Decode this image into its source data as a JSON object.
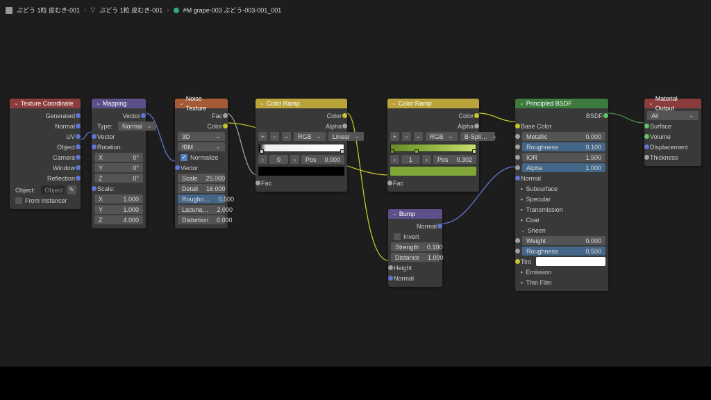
{
  "breadcrumb": {
    "a": "ぶどう 1粒 皮むき-001",
    "b": "ぶどう 1粒 皮むき-001",
    "c": "#M grape-003 ぶどう-003-001_001"
  },
  "texcoord": {
    "title": "Texture Coordinate",
    "outputs": [
      "Generated",
      "Normal",
      "UV",
      "Object",
      "Camera",
      "Window",
      "Reflection"
    ],
    "object_label": "Object:",
    "object_value": "Object",
    "from_instancer": "From Instancer"
  },
  "mapping": {
    "title": "Mapping",
    "out_vector": "Vector",
    "type_label": "Type:",
    "type_value": "Normal",
    "in_vector": "Vector",
    "rotation_label": "Rotation:",
    "rot": [
      [
        "X",
        "0°"
      ],
      [
        "Y",
        "0°"
      ],
      [
        "Z",
        "0°"
      ]
    ],
    "scale_label": "Scale:",
    "scale": [
      [
        "X",
        "1.000"
      ],
      [
        "Y",
        "1.000"
      ],
      [
        "Z",
        "4.000"
      ]
    ]
  },
  "noise": {
    "title": "Noise Texture",
    "out_fac": "Fac",
    "out_color": "Color",
    "dim": "3D",
    "mode": "fBM",
    "normalize": "Normalize",
    "in_vector": "Vector",
    "params": [
      [
        "Scale",
        "25.000"
      ],
      [
        "Detail",
        "16.000"
      ],
      [
        "Roughn…",
        "0.500"
      ],
      [
        "Lacuna…",
        "2.000"
      ],
      [
        "Distortion",
        "0.000"
      ]
    ]
  },
  "ramp1": {
    "title": "Color Ramp",
    "out_color": "Color",
    "out_alpha": "Alpha",
    "mode": "RGB",
    "interp": "Linear",
    "stop_index": "0",
    "pos_label": "Pos",
    "pos_value": "0.000",
    "in_fac": "Fac"
  },
  "ramp2": {
    "title": "Color Ramp",
    "out_color": "Color",
    "out_alpha": "Alpha",
    "mode": "RGB",
    "interp": "B-Spli…",
    "stop_index": "1",
    "pos_label": "Pos",
    "pos_value": "0.302",
    "in_fac": "Fac"
  },
  "bump": {
    "title": "Bump",
    "out_normal": "Normal",
    "invert": "Invert",
    "strength": [
      "Strength",
      "0.100"
    ],
    "distance": [
      "Distance",
      "1.000"
    ],
    "in_height": "Height",
    "in_normal": "Normal"
  },
  "bsdf": {
    "title": "Principled BSDF",
    "out_bsdf": "BSDF",
    "base_color": "Base Color",
    "metallic": [
      "Metallic",
      "0.000"
    ],
    "roughness": [
      "Roughness",
      "0.100"
    ],
    "ior": [
      "IOR",
      "1.500"
    ],
    "alpha": [
      "Alpha",
      "1.000"
    ],
    "normal": "Normal",
    "sections": [
      "Subsurface",
      "Specular",
      "Transmission",
      "Coat",
      "Sheen"
    ],
    "weight": [
      "Weight",
      "0.000"
    ],
    "sheen_roughness": [
      "Roughness",
      "0.500"
    ],
    "tint": "Tint",
    "sections2": [
      "Emission",
      "Thin Film"
    ]
  },
  "matout": {
    "title": "Material Output",
    "target": "All",
    "inputs": [
      "Surface",
      "Volume",
      "Displacement",
      "Thickness"
    ]
  }
}
